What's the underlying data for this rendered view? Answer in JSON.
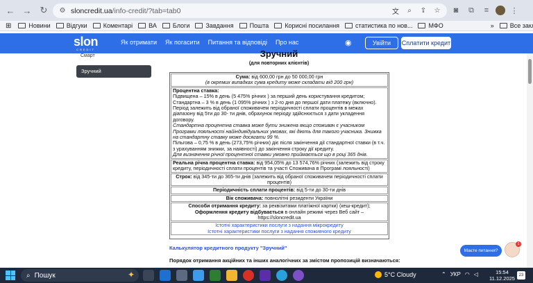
{
  "browser": {
    "url_host": "sloncredit.ua",
    "url_path": "/info-credit/?tab=tab0",
    "bookmarks": [
      "Новини",
      "Відгуки",
      "Коментарі",
      "ВА",
      "Блоги",
      "Завдання",
      "Пошта",
      "Корисні посилання",
      "статистика по нов...",
      "МФО"
    ],
    "all_bookmarks": "Все закладки"
  },
  "site": {
    "logo": "slon",
    "logo_sub": "CREDIT",
    "nav": [
      "Як отримати",
      "Як погасити",
      "Питання та відповіді",
      "Про нас"
    ],
    "login_label": "Увійти",
    "pay_label": "Сплатити кредит"
  },
  "sidebar": {
    "small_label": "Смарт",
    "active_item": "Зручний"
  },
  "content": {
    "title": "Зручний",
    "subtitle": "(для повторних клієнтів)",
    "sum_label": "Сума:",
    "sum_value": " від 600,00 грн до 50 000,00 грн",
    "sum_note": "(в окремих випадках сума кредиту може складати від 200 грн)",
    "rate_label": "Процентна ставка:",
    "rate_text_1": "Підвищена – 15% в день  (5 475% річних )  за перший день користування кредитом;",
    "rate_text_2": "Стандартна – 3 % в день (1 095% річних  )  з 2-го дня до першої дати платежу (включно).",
    "rate_text_3": "Період залежить  від обраної споживачем періодичності сплати процентів в межах діапазону від 5ти до 30- ти днів, обрахунок періоду здійснюється   з дати укладення договору.",
    "rate_text_4": "Стандартна процентна ставка може бути знижена якщо споживач є учасником Програми лояльності найіндивідуальних  умовах, які діють для такого учасника. Знижка на стандартну ставку може досягати 99 %.",
    "rate_text_5": "Пільгова – 0,75 % в день (273,75% річних)  діє після закінчення дії стандартної ставки (в т.ч. з урахуванням знижки, за наявності)  до закінчення строку дії кредиту.",
    "rate_text_6": "Для визначення річної процентної ставки умовно приймається що в році 365 днів.",
    "apr_label": "Реальна річна процентна ставка:",
    "apr_value": " від 954,05% до 13 574,76%  річних (залежить від строку кредиту, періодичності сплати процентів та участі Споживача в Програмі лояльності)",
    "term_label": "Строк:",
    "term_value": " від 345-ти до 365-ти днів (залежить від обраної споживачем періодичності сплати процентів)",
    "period_label": "Періодичність сплати процентів:",
    "period_value": " від 5-ти до 30-ти днів",
    "age_label": "Вік споживача:",
    "age_value": " повнолітні резиденти України",
    "methods_label": "Способи отримання кредиту:",
    "methods_value": " за реквізитами платіжної картки) (кеш-кредит);",
    "form_label": "Оформлення кредиту відбувається",
    "form_value": " в онлайн режимі через Веб сайт – https://sloncredit.ua",
    "link_1": "Істотні характеристики послуги з надання мікрокредиту",
    "link_2": "Істотні характеристики послуги з надання споживчого кредиту",
    "calculator": "Калькулятор кредитного продукту \"Зручний\"",
    "order": "Порядок отримання акційних та інших аналогічних за змістом пропозицій визначаються:"
  },
  "chat": {
    "label": "Маєте питання?",
    "badge": "1"
  },
  "taskbar": {
    "search": "Пошук",
    "weather": "5°C  Cloudy",
    "lang": "УКР",
    "time": "15:54",
    "date": "11.12.2025",
    "notif_count": "23"
  }
}
